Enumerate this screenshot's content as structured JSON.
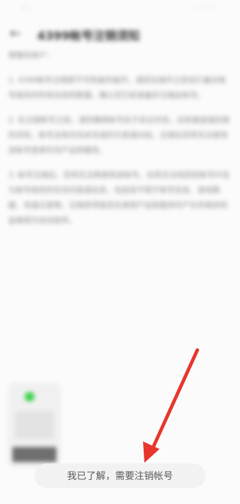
{
  "status_bar": {
    "left_text": "····",
    "right_text": "······"
  },
  "header": {
    "back_icon": "back-arrow-icon",
    "title": "4399帐号注销须知"
  },
  "article": {
    "paragraphs": [
      "尊敬的用户：",
      "1. 4399帐号注销是不可恢复的操作，请您在操作之前自行备份帐号相关的所有信息和数据，确认您已经准备好注销此帐号。",
      "2. 在注销帐号之前，请您确保帐号处于安全状态，没有被盗或封禁的风险，帐号没有任何未完成的交易或纠纷。注销后您将无法使用该帐号登录任何产品和服务。",
      "3. 帐号注销后，您将无法再使用该帐号，也将无法找回您帐号中及与帐号相关的任何内容或信息，包括但不限于帐号信息、游戏数据、充值记录等。注销将导致您在使用产品和服务时产生的相关权益被视为自动放弃。"
    ]
  },
  "thumbnail": {
    "dot_color": "#3bd24b"
  },
  "action": {
    "label": "我已了解，需要注销帐号"
  },
  "annotation": {
    "arrow_color": "#e8362c"
  }
}
